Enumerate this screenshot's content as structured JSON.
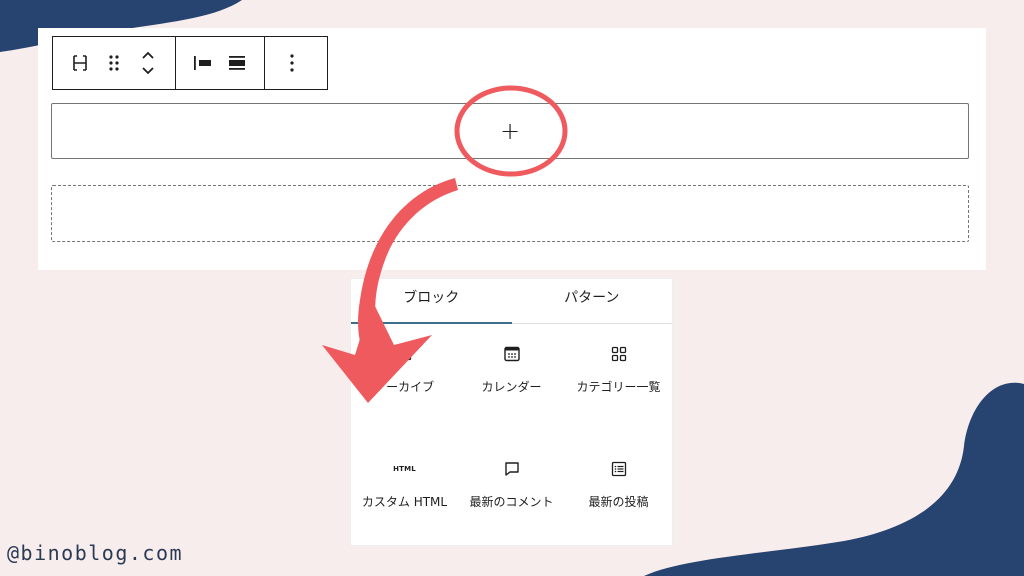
{
  "colors": {
    "background": "#f8eded",
    "blob": "#27436f",
    "annotation": "#ef5a5f",
    "tab_indicator": "#3a6e8a"
  },
  "toolbar": {
    "icons": [
      "ungroup-icon",
      "drag-handle-icon",
      "move-up-down-icon",
      "justify-left-icon",
      "justify-center-icon",
      "more-options-icon"
    ]
  },
  "editor": {
    "add_button_label": "+"
  },
  "inserter": {
    "tabs": [
      {
        "label": "ブロック",
        "active": true
      },
      {
        "label": "パターン",
        "active": false
      }
    ],
    "blocks": [
      {
        "label": "アーカイブ",
        "icon": "archive-icon"
      },
      {
        "label": "カレンダー",
        "icon": "calendar-icon"
      },
      {
        "label": "カテゴリー一覧",
        "icon": "categories-icon"
      },
      {
        "label": "カスタム HTML",
        "icon": "html-icon",
        "badge": "HTML"
      },
      {
        "label": "最新のコメント",
        "icon": "comment-icon"
      },
      {
        "label": "最新の投稿",
        "icon": "post-list-icon"
      }
    ]
  },
  "watermark": "@binoblog.com"
}
